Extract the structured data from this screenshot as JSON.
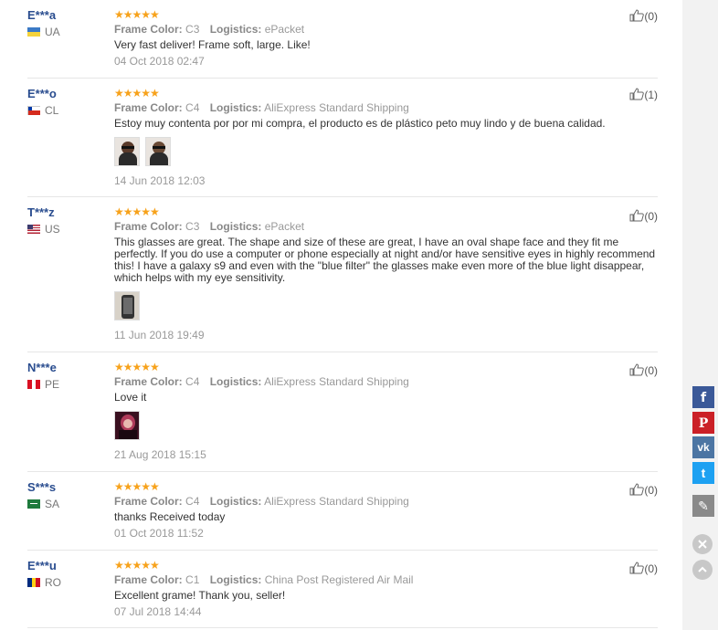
{
  "labels": {
    "frame_color": "Frame Color:",
    "logistics": "Logistics:"
  },
  "stars": "★★★★★",
  "reviews": [
    {
      "name": "E***a",
      "country": "UA",
      "frame": "C3",
      "logistics": "ePacket",
      "text": "Very fast deliver! Frame soft, large. Like!",
      "date": "04 Oct 2018 02:47",
      "helpful": "(0)"
    },
    {
      "name": "E***o",
      "country": "CL",
      "frame": "C4",
      "logistics": "AliExpress Standard Shipping",
      "text": "Estoy muy contenta por por mi compra, el producto es de plástico peto muy lindo y de buena calidad.",
      "date": "14 Jun 2018 12:03",
      "helpful": "(1)"
    },
    {
      "name": "T***z",
      "country": "US",
      "frame": "C3",
      "logistics": "ePacket",
      "text": "This glasses are great. The shape and size of these are great, I have an oval shape face and they fit me perfectly. If you do use a computer or phone especially at night and/or have sensitive eyes in highly recommend this! I have a galaxy s9 and even with the \"blue filter\" the glasses make even more of the blue light disappear, which helps with my eye sensitivity.",
      "date": "11 Jun 2018 19:49",
      "helpful": "(0)"
    },
    {
      "name": "N***e",
      "country": "PE",
      "frame": "C4",
      "logistics": "AliExpress Standard Shipping",
      "text": "Love it",
      "date": "21 Aug 2018 15:15",
      "helpful": "(0)"
    },
    {
      "name": "S***s",
      "country": "SA",
      "frame": "C4",
      "logistics": "AliExpress Standard Shipping",
      "text": "thanks Received today",
      "date": "01 Oct 2018 11:52",
      "helpful": "(0)"
    },
    {
      "name": "E***u",
      "country": "RO",
      "frame": "C1",
      "logistics": "China Post Registered Air Mail",
      "text": "Excellent grame! Thank you, seller!",
      "date": "07 Jul 2018 14:44",
      "helpful": "(0)"
    }
  ],
  "share_buttons": [
    {
      "icon": "facebook-icon",
      "glyph": "f",
      "color": "#3b5998"
    },
    {
      "icon": "pinterest-icon",
      "glyph": "P",
      "color": "#cb2027"
    },
    {
      "icon": "vk-icon",
      "glyph": "vk",
      "color": "#4c75a3"
    },
    {
      "icon": "twitter-icon",
      "glyph": "t",
      "color": "#1da1f2"
    },
    {
      "icon": "edit-icon",
      "glyph": "✎",
      "color": "#8a8a8a"
    }
  ]
}
